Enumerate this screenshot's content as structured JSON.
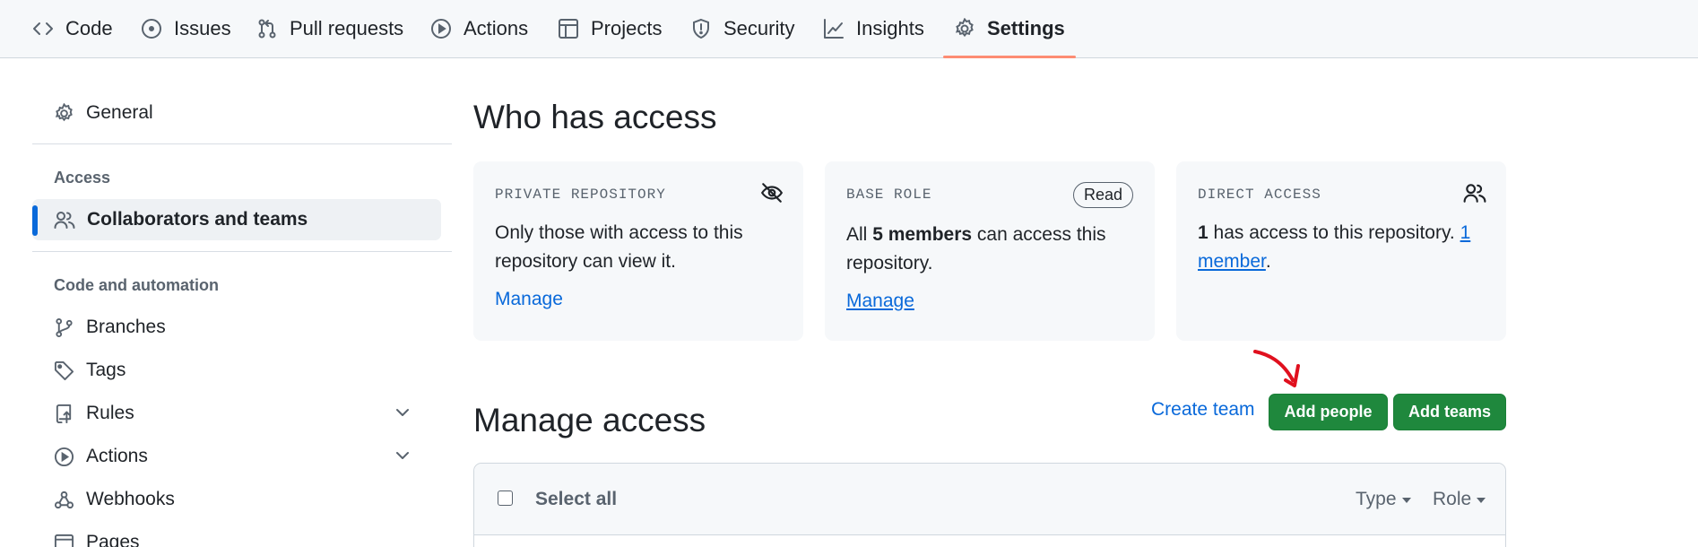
{
  "repo_nav": {
    "tabs": [
      {
        "label": "Code",
        "icon": "code-icon"
      },
      {
        "label": "Issues",
        "icon": "issue-opened-icon"
      },
      {
        "label": "Pull requests",
        "icon": "git-pull-request-icon"
      },
      {
        "label": "Actions",
        "icon": "play-icon"
      },
      {
        "label": "Projects",
        "icon": "table-icon"
      },
      {
        "label": "Security",
        "icon": "shield-icon"
      },
      {
        "label": "Insights",
        "icon": "graph-icon"
      },
      {
        "label": "Settings",
        "icon": "gear-icon",
        "active": true
      }
    ]
  },
  "sidebar": {
    "general": "General",
    "access_heading": "Access",
    "collaborators": "Collaborators and teams",
    "code_heading": "Code and automation",
    "items": [
      {
        "label": "Branches",
        "icon": "git-branch-icon"
      },
      {
        "label": "Tags",
        "icon": "tag-icon"
      },
      {
        "label": "Rules",
        "icon": "repo-push-icon",
        "expandable": true
      },
      {
        "label": "Actions",
        "icon": "play-icon",
        "expandable": true
      },
      {
        "label": "Webhooks",
        "icon": "webhook-icon"
      },
      {
        "label": "Pages",
        "icon": "browser-icon"
      }
    ]
  },
  "who_has_access": {
    "title": "Who has access",
    "cards": [
      {
        "label": "PRIVATE REPOSITORY",
        "icon": "eye-closed-icon",
        "text": "Only those with access to this repository can view it.",
        "link": "Manage"
      },
      {
        "label": "BASE ROLE",
        "badge": "Read",
        "text_prefix": "All ",
        "text_bold": "5 members",
        "text_suffix": " can access this repository.",
        "link": "Manage"
      },
      {
        "label": "DIRECT ACCESS",
        "icon": "people-icon",
        "text_bold": "1",
        "text_middle": " has access to this repository. ",
        "text_link": "1 member",
        "text_end": "."
      }
    ]
  },
  "manage_access": {
    "title": "Manage access",
    "create_team": "Create team",
    "add_people": "Add people",
    "add_teams": "Add teams",
    "select_all": "Select all",
    "filters": [
      "Type",
      "Role"
    ]
  },
  "colors": {
    "accent": "#0969da",
    "primary_button": "#1f883d",
    "active_tab_underline": "#fd8c73",
    "annotation_arrow": "#e0101e"
  }
}
